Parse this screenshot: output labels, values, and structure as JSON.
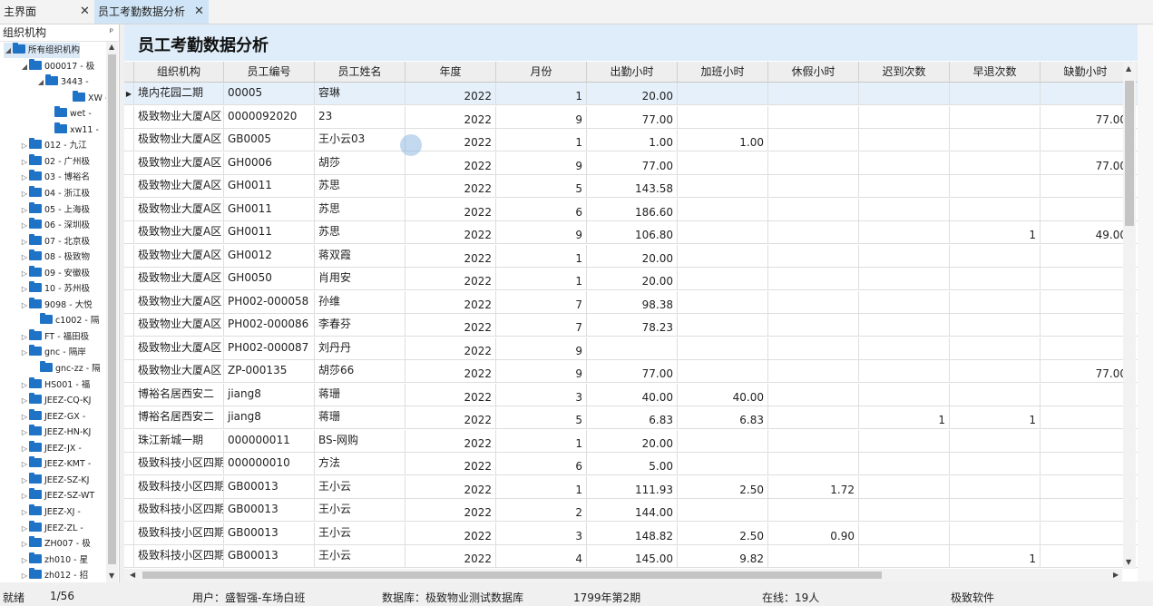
{
  "tabs": [
    {
      "label": "主界面"
    },
    {
      "label": "员工考勤数据分析"
    }
  ],
  "sidebar": {
    "title": "组织机构",
    "pin": "ㅁ",
    "items": [
      {
        "label": "所有组织机构"
      },
      {
        "label": "000017 - 极"
      },
      {
        "label": "3443 -"
      },
      {
        "label": "XW -"
      },
      {
        "label": "wet -"
      },
      {
        "label": "xw11 -"
      },
      {
        "label": "012 - 九江"
      },
      {
        "label": "02 - 广州极"
      },
      {
        "label": "03 - 博裕名"
      },
      {
        "label": "04 - 浙江极"
      },
      {
        "label": "05 - 上海极"
      },
      {
        "label": "06 - 深圳极"
      },
      {
        "label": "07 - 北京极"
      },
      {
        "label": "08 - 极致物"
      },
      {
        "label": "09 - 安徽极"
      },
      {
        "label": "10 - 苏州极"
      },
      {
        "label": "9098 - 大悦"
      },
      {
        "label": "c1002 - 隔"
      },
      {
        "label": "FT - 福田极"
      },
      {
        "label": "gnc - 隔岸"
      },
      {
        "label": "gnc-zz - 隔"
      },
      {
        "label": "HS001 - 福"
      },
      {
        "label": "JEEZ-CQ-KJ"
      },
      {
        "label": "JEEZ-GX -"
      },
      {
        "label": "JEEZ-HN-KJ"
      },
      {
        "label": "JEEZ-JX -"
      },
      {
        "label": "JEEZ-KMT -"
      },
      {
        "label": "JEEZ-SZ-KJ"
      },
      {
        "label": "JEEZ-SZ-WT"
      },
      {
        "label": "JEEZ-XJ -"
      },
      {
        "label": "JEEZ-ZL -"
      },
      {
        "label": "ZH007 - 极"
      },
      {
        "label": "zh010 - 星"
      },
      {
        "label": "zh012 - 招"
      }
    ]
  },
  "main": {
    "title": "员工考勤数据分析",
    "columns": [
      "组织机构",
      "员工编号",
      "员工姓名",
      "年度",
      "月份",
      "出勤小时",
      "加班小时",
      "休假小时",
      "迟到次数",
      "早退次数",
      "缺勤小时"
    ],
    "rows": [
      [
        "境内花园二期",
        "00005",
        "容琳",
        "2022",
        "1",
        "20.00",
        "",
        "",
        "",
        "",
        ""
      ],
      [
        "极致物业大厦A区",
        "0000092020",
        "23",
        "2022",
        "9",
        "77.00",
        "",
        "",
        "",
        "",
        "77.00"
      ],
      [
        "极致物业大厦A区",
        "GB0005",
        "王小云03",
        "2022",
        "1",
        "1.00",
        "1.00",
        "",
        "",
        "",
        ""
      ],
      [
        "极致物业大厦A区",
        "GH0006",
        "胡莎",
        "2022",
        "9",
        "77.00",
        "",
        "",
        "",
        "",
        "77.00"
      ],
      [
        "极致物业大厦A区",
        "GH0011",
        "苏思",
        "2022",
        "5",
        "143.58",
        "",
        "",
        "",
        "",
        ""
      ],
      [
        "极致物业大厦A区",
        "GH0011",
        "苏思",
        "2022",
        "6",
        "186.60",
        "",
        "",
        "",
        "",
        ""
      ],
      [
        "极致物业大厦A区",
        "GH0011",
        "苏思",
        "2022",
        "9",
        "106.80",
        "",
        "",
        "",
        "1",
        "49.00"
      ],
      [
        "极致物业大厦A区",
        "GH0012",
        "蒋双霞",
        "2022",
        "1",
        "20.00",
        "",
        "",
        "",
        "",
        ""
      ],
      [
        "极致物业大厦A区",
        "GH0050",
        "肖用安",
        "2022",
        "1",
        "20.00",
        "",
        "",
        "",
        "",
        ""
      ],
      [
        "极致物业大厦A区",
        "PH002-000058",
        "孙维",
        "2022",
        "7",
        "98.38",
        "",
        "",
        "",
        "",
        ""
      ],
      [
        "极致物业大厦A区",
        "PH002-000086",
        "李春芬",
        "2022",
        "7",
        "78.23",
        "",
        "",
        "",
        "",
        ""
      ],
      [
        "极致物业大厦A区",
        "PH002-000087",
        "刘丹丹",
        "2022",
        "9",
        "",
        "",
        "",
        "",
        "",
        ""
      ],
      [
        "极致物业大厦A区",
        "ZP-000135",
        "胡莎66",
        "2022",
        "9",
        "77.00",
        "",
        "",
        "",
        "",
        "77.00"
      ],
      [
        "博裕名居西安二",
        "jiang8",
        "蒋珊",
        "2022",
        "3",
        "40.00",
        "40.00",
        "",
        "",
        "",
        ""
      ],
      [
        "博裕名居西安二",
        "jiang8",
        "蒋珊",
        "2022",
        "5",
        "6.83",
        "6.83",
        "",
        "1",
        "1",
        ""
      ],
      [
        "珠江新城一期",
        "000000011",
        "BS-网购",
        "2022",
        "1",
        "20.00",
        "",
        "",
        "",
        "",
        ""
      ],
      [
        "极致科技小区四期",
        "000000010",
        "方法",
        "2022",
        "6",
        "5.00",
        "",
        "",
        "",
        "",
        ""
      ],
      [
        "极致科技小区四期",
        "GB00013",
        "王小云",
        "2022",
        "1",
        "111.93",
        "2.50",
        "1.72",
        "",
        "",
        ""
      ],
      [
        "极致科技小区四期",
        "GB00013",
        "王小云",
        "2022",
        "2",
        "144.00",
        "",
        "",
        "",
        "",
        ""
      ],
      [
        "极致科技小区四期",
        "GB00013",
        "王小云",
        "2022",
        "3",
        "148.82",
        "2.50",
        "0.90",
        "",
        "",
        ""
      ],
      [
        "极致科技小区四期",
        "GB00013",
        "王小云",
        "2022",
        "4",
        "145.00",
        "9.82",
        "",
        "",
        "1",
        ""
      ]
    ]
  },
  "status": {
    "state": "就绪",
    "page": "1/56",
    "user": "用户：盛智强-车场白班",
    "db": "数据库：极致物业测试数据库",
    "period": "1799年第2期",
    "online": "在线：19人",
    "company": "极致软件"
  }
}
